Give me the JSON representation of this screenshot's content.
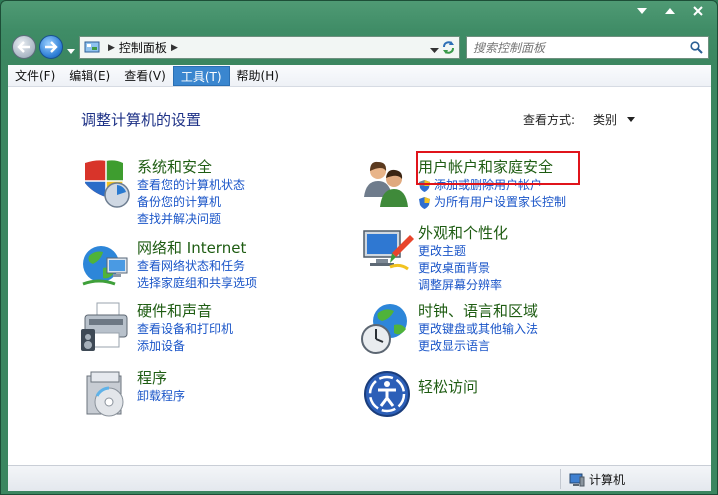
{
  "address": {
    "crumb": "控制面板"
  },
  "search": {
    "placeholder": "搜索控制面板"
  },
  "menu": [
    {
      "label": "文件(F)"
    },
    {
      "label": "编辑(E)"
    },
    {
      "label": "查看(V)"
    },
    {
      "label": "工具(T)"
    },
    {
      "label": "帮助(H)"
    }
  ],
  "page": {
    "title": "调整计算机的设置",
    "view_by_label": "查看方式:",
    "view_by_value": "类别"
  },
  "categories": {
    "system": {
      "title": "系统和安全",
      "links": [
        "查看您的计算机状态",
        "备份您的计算机",
        "查找并解决问题"
      ]
    },
    "network": {
      "title": "网络和 Internet",
      "links": [
        "查看网络状态和任务",
        "选择家庭组和共享选项"
      ]
    },
    "hardware": {
      "title": "硬件和声音",
      "links": [
        "查看设备和打印机",
        "添加设备"
      ]
    },
    "programs": {
      "title": "程序",
      "links": [
        "卸载程序"
      ]
    },
    "users": {
      "title": "用户帐户和家庭安全",
      "links": [
        "添加或删除用户帐户",
        "为所有用户设置家长控制"
      ]
    },
    "appearance": {
      "title": "外观和个性化",
      "links": [
        "更改主题",
        "更改桌面背景",
        "调整屏幕分辨率"
      ]
    },
    "clock": {
      "title": "时钟、语言和区域",
      "links": [
        "更改键盘或其他输入法",
        "更改显示语言"
      ]
    },
    "access": {
      "title": "轻松访问",
      "links": []
    }
  },
  "status": {
    "computer": "计算机"
  },
  "colors": {
    "frame": "#3b8660",
    "menu_active": "#3a86cf",
    "category_title": "#1e5c12",
    "link": "#1a55c8",
    "highlight": "#e0141b"
  }
}
